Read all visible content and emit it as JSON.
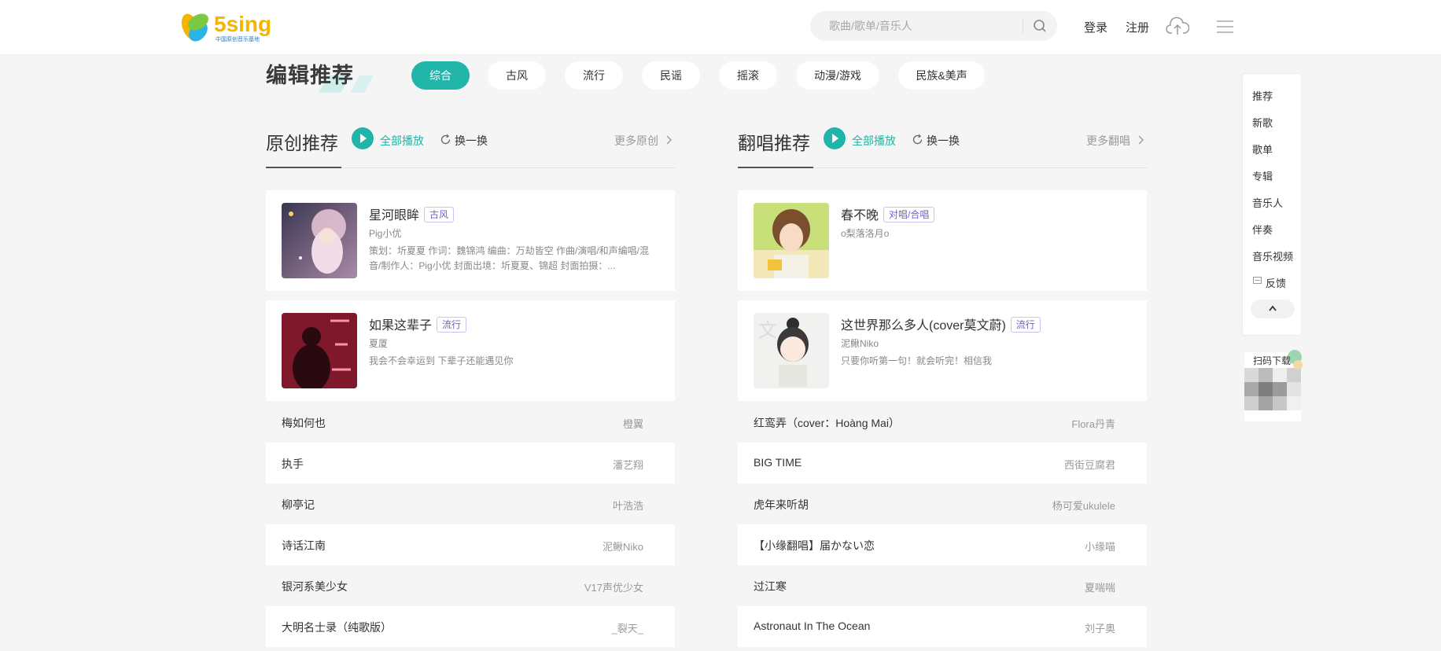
{
  "header": {
    "logo_text": "5sing",
    "logo_subtitle": "中国原创音乐基地",
    "search_placeholder": "歌曲/歌单/音乐人",
    "login": "登录",
    "register": "注册",
    "upload_icon": "upload-cloud-icon",
    "menu_icon": "menu-icon"
  },
  "editor": {
    "title": "编辑推荐",
    "categories": [
      {
        "label": "综合",
        "active": true
      },
      {
        "label": "古风",
        "active": false
      },
      {
        "label": "流行",
        "active": false
      },
      {
        "label": "民谣",
        "active": false
      },
      {
        "label": "摇滚",
        "active": false
      },
      {
        "label": "动漫/游戏",
        "active": false
      },
      {
        "label": "民族&美声",
        "active": false
      }
    ]
  },
  "original": {
    "title": "原创推荐",
    "play_all": "全部播放",
    "refresh": "换一换",
    "more": "更多原创",
    "featured": [
      {
        "title": "星河眼眸",
        "tag": "古风",
        "author": "Pig小优",
        "desc": "策划：圻夏夏 作词：魏锦鸿 编曲：万劫皆空 作曲/演唱/和声编唱/混音/制作人：Pig小优 封面出境：圻夏夏、锦超 封面拍摄：..."
      },
      {
        "title": "如果这辈子",
        "tag": "流行",
        "author": "夏厦",
        "desc": "我会不会幸运到 下辈子还能遇见你"
      }
    ],
    "list": [
      {
        "name": "梅如何也",
        "artist": "橙翼"
      },
      {
        "name": "执手",
        "artist": "潘艺翔"
      },
      {
        "name": "柳亭记",
        "artist": "叶浩浩"
      },
      {
        "name": "诗话江南",
        "artist": "泥鳅Niko"
      },
      {
        "name": "银河系美少女",
        "artist": "V17声优少女"
      },
      {
        "name": "大明名士录（纯歌版）",
        "artist": "_裂天_"
      }
    ]
  },
  "cover": {
    "title": "翻唱推荐",
    "play_all": "全部播放",
    "refresh": "换一换",
    "more": "更多翻唱",
    "featured": [
      {
        "title": "春不晚",
        "tag": "对唱/合唱",
        "author": "o梨落洛月o",
        "desc": ""
      },
      {
        "title": "这世界那么多人(cover莫文蔚)",
        "tag": "流行",
        "author": "泥鳅Niko",
        "desc": "只要你听第一句！就会听完！相信我"
      }
    ],
    "list": [
      {
        "name": "红鸾弄（cover：Hoàng Mai）",
        "artist": "Flora丹青"
      },
      {
        "name": "BIG TIME",
        "artist": "西街豆腐君"
      },
      {
        "name": "虎年来听胡",
        "artist": "杨可爱ukulele"
      },
      {
        "name": "【小缘翻唱】届かない恋",
        "artist": "小缘喵"
      },
      {
        "name": "过江寒",
        "artist": "夏喘喘"
      },
      {
        "name": "Astronaut In The Ocean",
        "artist": "刘子奥"
      }
    ]
  },
  "sidebar": {
    "items": [
      "推荐",
      "新歌",
      "歌单",
      "专辑",
      "音乐人",
      "伴奏",
      "音乐视频",
      "反馈"
    ],
    "qr_label": "扫码下载"
  },
  "colors": {
    "accent": "#21b4a8",
    "tag": "#6c63d0"
  }
}
